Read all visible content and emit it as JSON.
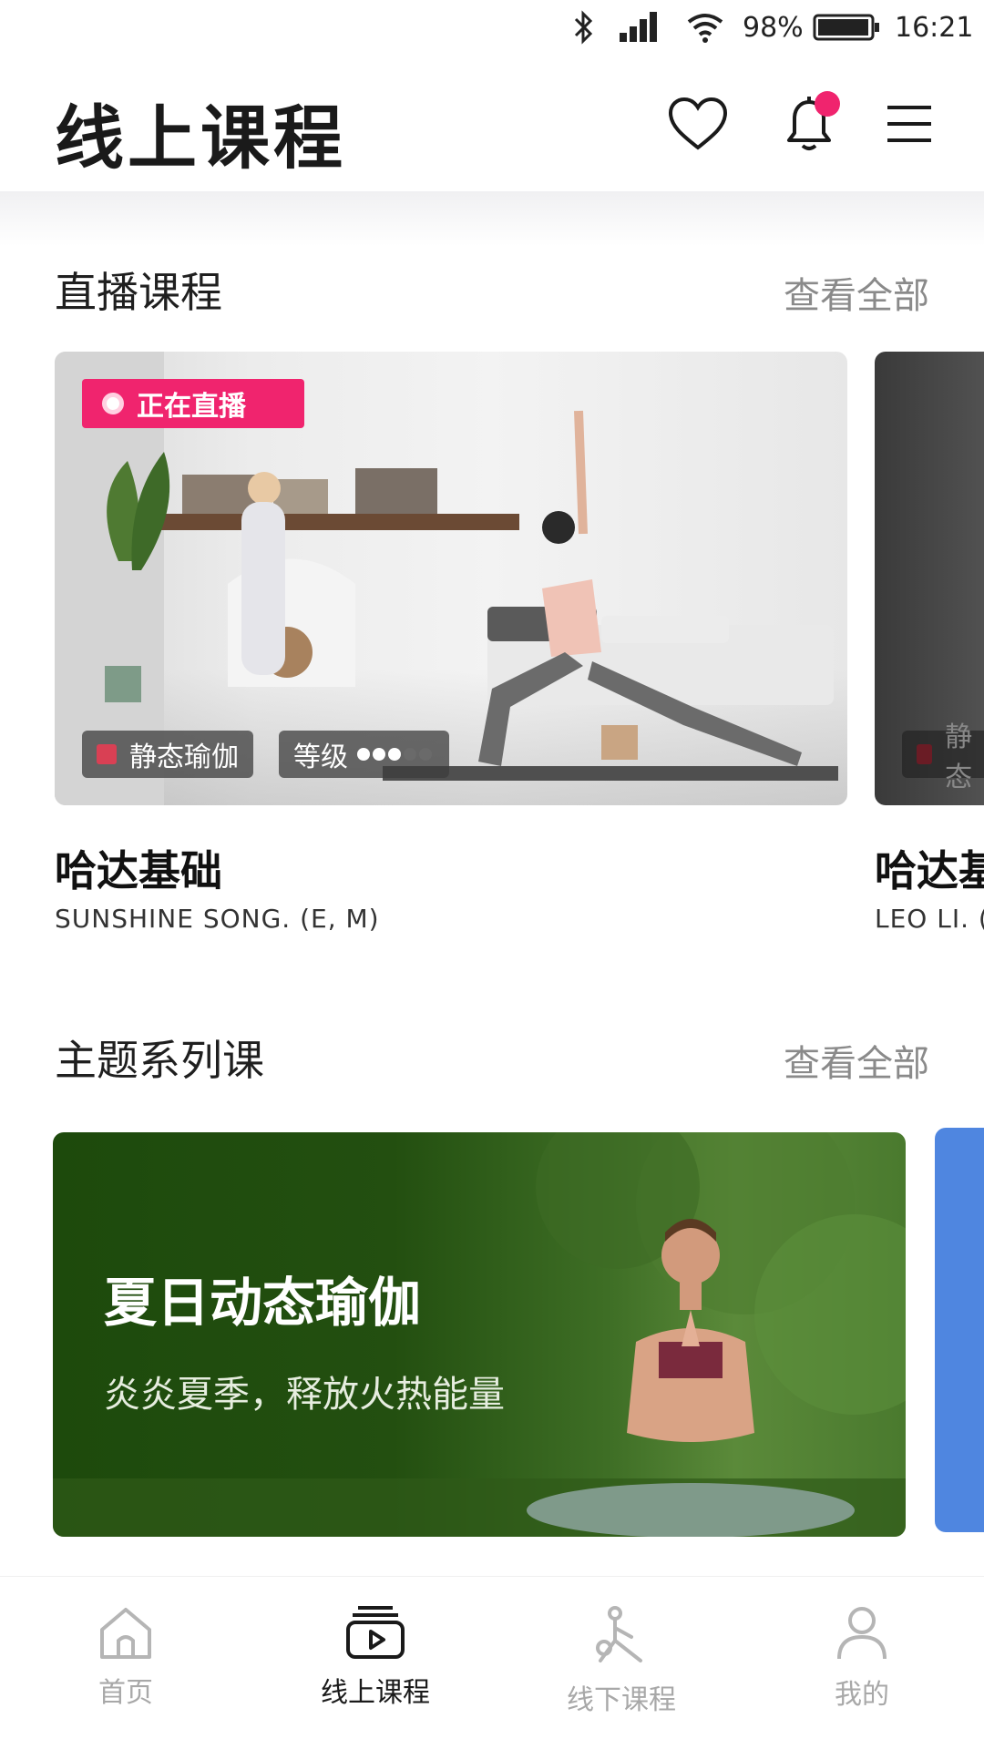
{
  "status_bar": {
    "battery": "98%",
    "time": "16:21"
  },
  "header": {
    "title": "线上课程"
  },
  "live_section": {
    "title": "直播课程",
    "view_all": "查看全部",
    "cards": [
      {
        "badge": "正在直播",
        "style_tag": "静态瑜伽",
        "level_label": "等级",
        "level": 3,
        "level_max": 5,
        "name": "哈达基础",
        "teacher": "SUNSHINE SONG. (E, M)"
      },
      {
        "style_tag": "静态",
        "name": "哈达基",
        "teacher": "LEO LI. ("
      }
    ]
  },
  "theme_section": {
    "title": "主题系列课",
    "view_all": "查看全部",
    "banner": {
      "title": "夏日动态瑜伽",
      "subtitle": "炎炎夏季，释放火热能量"
    }
  },
  "tabbar": {
    "items": [
      {
        "label": "首页",
        "icon": "home-icon"
      },
      {
        "label": "线上课程",
        "icon": "video-course-icon",
        "active": true
      },
      {
        "label": "线下课程",
        "icon": "yoga-pose-icon"
      },
      {
        "label": "我的",
        "icon": "person-icon"
      }
    ]
  },
  "colors": {
    "accent": "#f0246e",
    "tag_square": "#d94054",
    "banner_green": "#234f10",
    "banner_blue": "#4f86e0"
  }
}
